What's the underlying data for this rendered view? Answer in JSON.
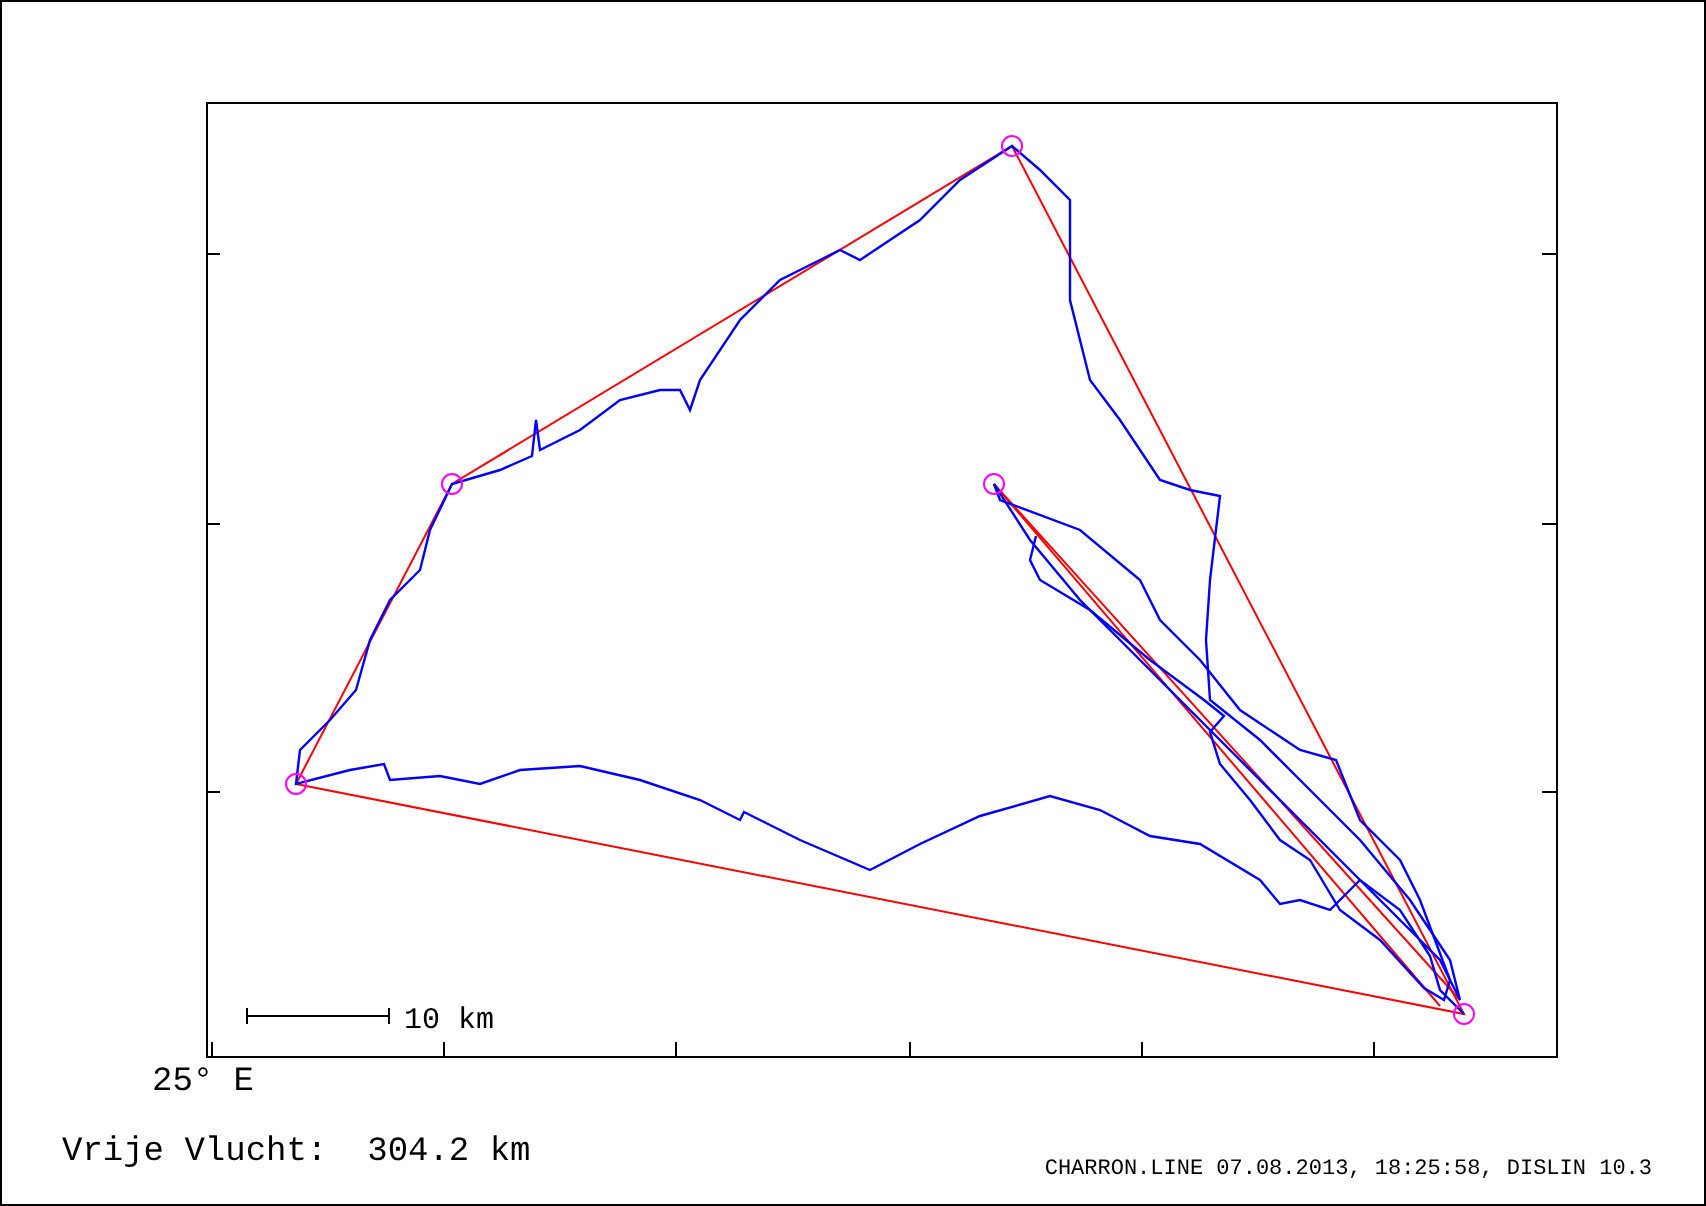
{
  "map": {
    "scale_label": "10 km",
    "longitude_label": "25° E"
  },
  "distance": {
    "label": "Vrije Vlucht:",
    "value": "304.2 km"
  },
  "footer": "CHARRON.LINE 07.08.2013, 18:25:58, DISLIN 10.3"
}
